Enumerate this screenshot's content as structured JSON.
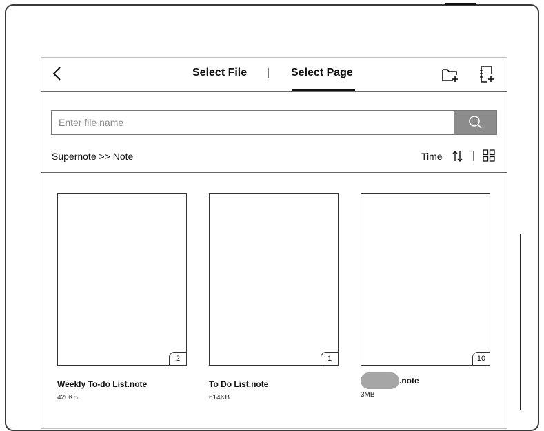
{
  "header": {
    "tabs": [
      {
        "label": "Select File",
        "active": false
      },
      {
        "label": "Select Page",
        "active": true
      }
    ],
    "icons": [
      "back-chevron-icon",
      "new-folder-icon",
      "new-note-icon"
    ]
  },
  "search": {
    "placeholder": "Enter file name",
    "value": "",
    "button_icon": "search-icon"
  },
  "breadcrumb": "Supernote >> Note",
  "sort": {
    "label": "Time",
    "icon": "sort-order-icon",
    "view_icon": "grid-view-icon"
  },
  "files": [
    {
      "name": "Weekly To-do List.note",
      "size": "420KB",
      "pages": "2"
    },
    {
      "name": "To Do List.note",
      "size": "614KB",
      "pages": "1"
    },
    {
      "name": ".note",
      "size": "3MB",
      "pages": "10",
      "name_redacted": true
    }
  ],
  "colors": {
    "frame": "#3a3a3a",
    "search_button": "#8c8c8c",
    "redaction": "#a6a6a6"
  }
}
